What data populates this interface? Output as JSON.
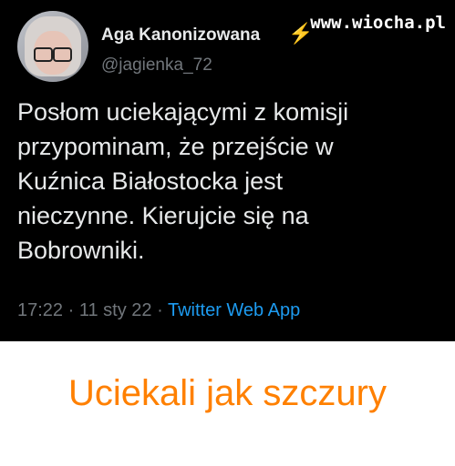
{
  "tweet": {
    "author_name": "Aga Kanonizowana",
    "handle": "@jagienka_72",
    "text": "Posłom uciekającymi z komisji\nprzypominam, że przejście w\nKuźnica Białostocka jest\nnieczynne. Kierujcie się na\nBobrowniki.",
    "time": "17:22",
    "date": "11 sty 22",
    "source": "Twitter Web App",
    "separator": " · "
  },
  "watermark": "www.wiocha.pl",
  "caption": "Uciekali jak szczury",
  "colors": {
    "background": "#000000",
    "text": "#e7e9ea",
    "muted": "#71767b",
    "link": "#1d9bf0",
    "caption": "#ff8000",
    "bolt": "#f7c600"
  },
  "icons": {
    "verified_badge": "lightning-bolt-icon"
  }
}
